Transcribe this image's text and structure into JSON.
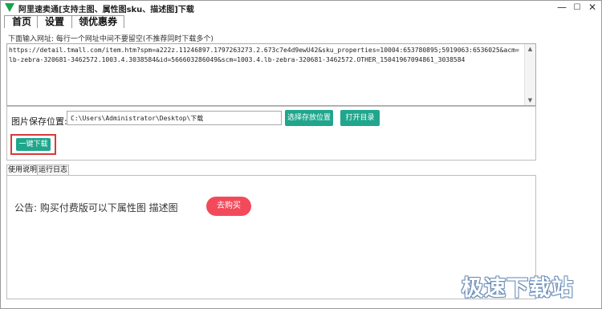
{
  "window": {
    "title": "阿里速卖通[支持主图、属性图sku、描述图]下载",
    "controls": {
      "minimize": "—",
      "maximize": "☐",
      "close": "✕"
    }
  },
  "menu": {
    "items": [
      "首页",
      "设置",
      "领优惠券"
    ]
  },
  "url_section": {
    "label": "下面输入网址:   每行一个网址中间不要留空(不推荐同时下载多个)",
    "value": "https://detail.tmall.com/item.htm?spm=a222z.11246897.1797263273.2.673c7e4d9ewU42&sku_properties=10004:653780895;5919063:6536025&acm=lb-zebra-320681-3462572.1003.4.3038584&id=566603286049&scm=1003.4.lb-zebra-320681-3462572.OTHER_15041967094861_3038584"
  },
  "save_section": {
    "label": "图片保存位置:",
    "path": "C:\\Users\\Administrator\\Desktop\\下载",
    "choose_button": "选择存放位置",
    "open_button": "打开目录",
    "download_button": "一键下载"
  },
  "tabs": [
    "使用说明",
    "运行日志"
  ],
  "panel": {
    "notice": "公告: 购买付费版可以下属性图  描述图",
    "buy_button": "去购买"
  },
  "watermark": "极速下载站",
  "icons": {
    "app": "green-down-arrow-icon"
  },
  "colors": {
    "teal": "#1fa68c",
    "buy": "#f24a5b",
    "highlight_border": "#d9383a"
  }
}
